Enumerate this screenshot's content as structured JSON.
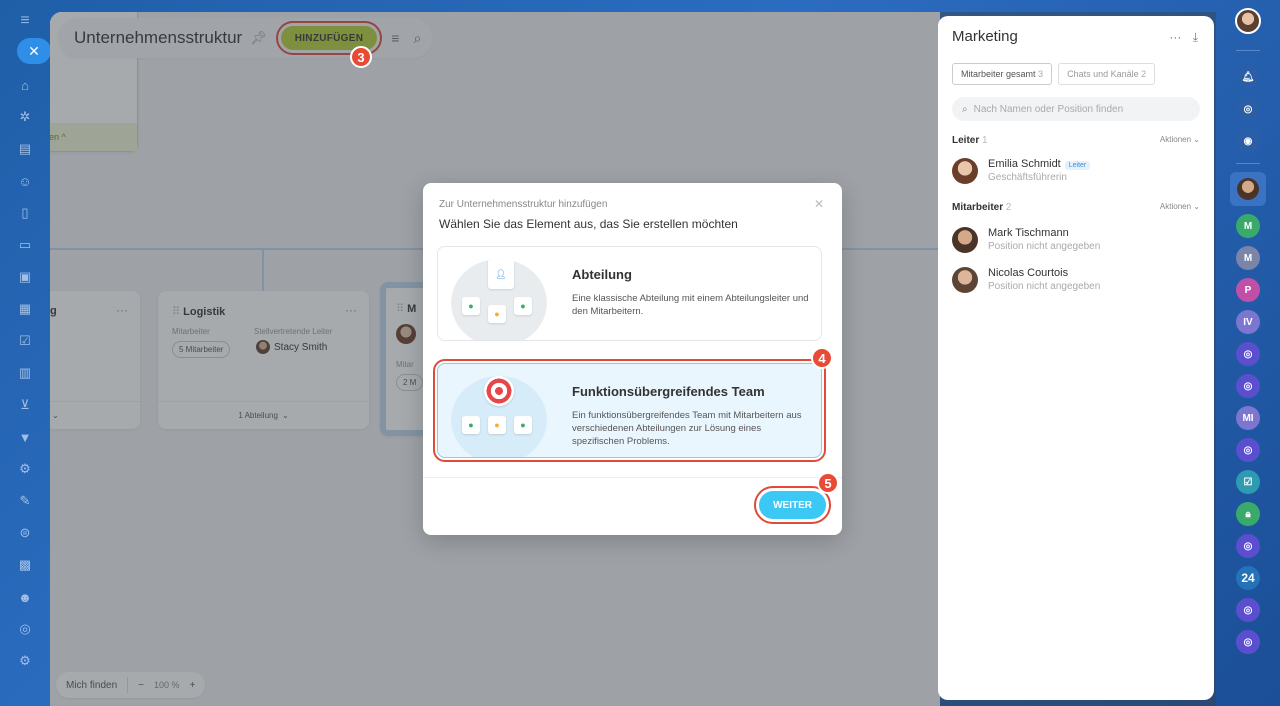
{
  "toolbar": {
    "title": "Unternehmensstruktur",
    "add_label": "HINZUFÜGEN"
  },
  "steps": {
    "s3": "3",
    "s4": "4",
    "s5": "5"
  },
  "canvas": {
    "partial_node_footer": "en ^",
    "left_node_title": "g",
    "logistik": {
      "title": "Logistik",
      "label_employees": "Mitarbeiter",
      "label_deputy": "Stellvertretende Leiter",
      "employees_pill": "5 Mitarbeiter",
      "deputy_name": "Stacy Smith",
      "footer": "1 Abteilung"
    },
    "marketing_node": {
      "title": "M",
      "label": "Mitar",
      "pill": "2 M"
    },
    "zoom": {
      "find_me": "Mich finden",
      "zoom_level": "100 %"
    }
  },
  "panel": {
    "title": "Marketing",
    "tabs": [
      {
        "label": "Mitarbeiter gesamt",
        "count": "3"
      },
      {
        "label": "Chats und Kanäle",
        "count": "2"
      }
    ],
    "search_placeholder": "Nach Namen oder Position finden",
    "leader_section": {
      "name": "Leiter",
      "count": "1",
      "action": "Aktionen"
    },
    "leader": {
      "name": "Emilia Schmidt",
      "badge": "Leiter",
      "role": "Geschäftsführerin"
    },
    "employee_section": {
      "name": "Mitarbeiter",
      "count": "2",
      "action": "Aktionen"
    },
    "employees": [
      {
        "name": "Mark Tischmann",
        "role": "Position nicht angegeben"
      },
      {
        "name": "Nicolas Courtois",
        "role": "Position nicht angegeben"
      }
    ]
  },
  "modal": {
    "subtitle": "Zur Unternehmensstruktur hinzufügen",
    "title": "Wählen Sie das Element aus, das Sie erstellen möchten",
    "options": [
      {
        "title": "Abteilung",
        "description": "Eine klassische Abteilung mit einem Abteilungsleiter und den Mitarbeitern."
      },
      {
        "title": "Funktionsübergreifendes Team",
        "description": "Ein funktionsübergreifendes Team mit Mitarbeitern aus verschiedenen Abteilungen zur Lösung eines spezifischen Problems."
      }
    ],
    "next_label": "WEITER"
  },
  "right_bar": {
    "badge_m": "M",
    "badge_p": "P",
    "badge_iv": "IV",
    "badge_mi": "MI",
    "badge_24": "24"
  },
  "colors": {
    "accent_green": "#b4d033",
    "accent_blue": "#3bc8f5",
    "highlight_red": "#e04a3a"
  }
}
